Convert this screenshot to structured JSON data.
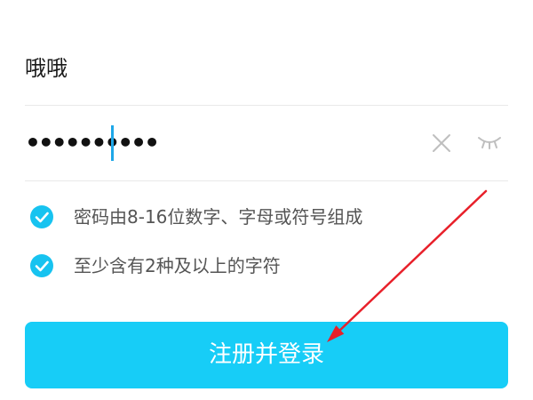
{
  "form": {
    "username": "哦哦",
    "password_masked": "••••••••••",
    "clear_icon": "close-icon",
    "visibility_icon": "eye-closed-icon"
  },
  "rules": [
    {
      "text": "密码由8-16位数字、字母或符号组成",
      "checked": true
    },
    {
      "text": "至少含有2种及以上的字符",
      "checked": true
    }
  ],
  "submit": {
    "label": "注册并登录"
  },
  "annotation": {
    "type": "arrow",
    "color": "#e8202a"
  },
  "colors": {
    "accent": "#17cdf7",
    "check": "#17c3f0",
    "caret": "#1ea7e8",
    "arrow": "#e8202a"
  }
}
